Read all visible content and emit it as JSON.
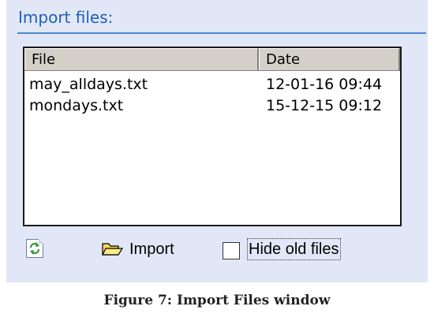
{
  "panel": {
    "title": "Import files:"
  },
  "file_list": {
    "columns": [
      "File",
      "Date"
    ],
    "rows": [
      {
        "file": "may_alldays.txt",
        "date": "12-01-16 09:44"
      },
      {
        "file": "mondays.txt",
        "date": "15-12-15 09:12"
      }
    ]
  },
  "toolbar": {
    "refresh_icon": "refresh-icon",
    "import_icon": "folder-open-icon",
    "import_label": "Import",
    "hide_old_label": "Hide old files",
    "hide_old_checked": false
  },
  "caption": "Figure 7: Import Files window",
  "colors": {
    "panel_bg": "#e1e7f6",
    "title_text": "#1f5fb6",
    "title_rule": "#4a88cf"
  }
}
